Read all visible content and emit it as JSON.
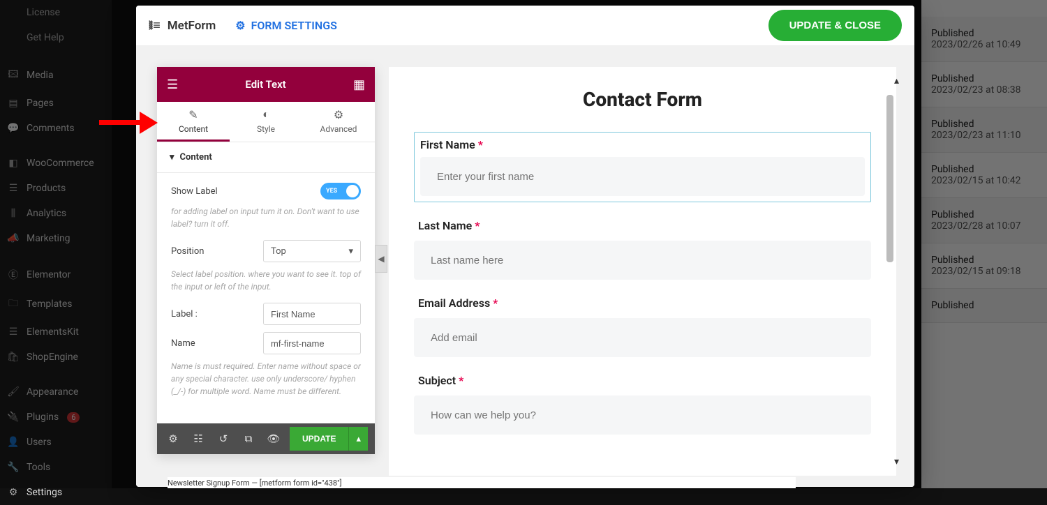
{
  "wp": {
    "items": [
      "License",
      "Get Help",
      "Media",
      "Pages",
      "Comments",
      "WooCommerce",
      "Products",
      "Analytics",
      "Marketing",
      "Elementor",
      "Templates",
      "ElementsKit",
      "ShopEngine",
      "Appearance",
      "Plugins",
      "Users",
      "Tools",
      "Settings"
    ],
    "plugins_badge": "6"
  },
  "posts": [
    {
      "status": "Published",
      "date": "2023/02/26 at 10:49",
      "alt": true
    },
    {
      "status": "Published",
      "date": "2023/02/23 at 08:38",
      "alt": false
    },
    {
      "status": "Published",
      "date": "2023/02/23 at 11:10",
      "alt": true
    },
    {
      "status": "Published",
      "date": "2023/02/15 at 10:42",
      "alt": false
    },
    {
      "status": "Published",
      "date": "2023/02/28 at 10:07",
      "alt": true
    },
    {
      "status": "Published",
      "date": "2023/02/15 at 09:18",
      "alt": false
    },
    {
      "status": "Published",
      "date": "",
      "alt": true
    }
  ],
  "modal": {
    "brand": "MetForm",
    "settings_label": "FORM SETTINGS",
    "update_close": "UPDATE & CLOSE"
  },
  "editor": {
    "title": "Edit Text",
    "tabs": {
      "content": "Content",
      "style": "Style",
      "advanced": "Advanced"
    },
    "section": "Content",
    "controls": {
      "show_label": "Show Label",
      "show_label_toggle_txt": "YES",
      "show_label_help": "for adding label on input turn it on. Don't want to use label? turn it off.",
      "position": "Position",
      "position_value": "Top",
      "position_help": "Select label position. where you want to see it. top of the input or left of the input.",
      "label": "Label :",
      "label_value": "First Name",
      "name": "Name",
      "name_value": "mf-first-name",
      "name_help": "Name is must required. Enter name without space or any special character. use only underscore/ hyphen (_/-) for multiple word. Name must be different."
    },
    "footer_update": "UPDATE"
  },
  "preview": {
    "heading": "Contact Form",
    "fields": [
      {
        "label": "First Name",
        "required": true,
        "placeholder": "Enter your first name",
        "selected": true
      },
      {
        "label": "Last Name",
        "required": true,
        "placeholder": "Last name here",
        "selected": false
      },
      {
        "label": "Email Address",
        "required": true,
        "placeholder": "Add email",
        "selected": false
      },
      {
        "label": "Subject",
        "required": true,
        "placeholder": "How can we help you?",
        "selected": false
      }
    ]
  },
  "hint_row_text": "Newsletter Signup Form — [metform form id=\"438\"]"
}
